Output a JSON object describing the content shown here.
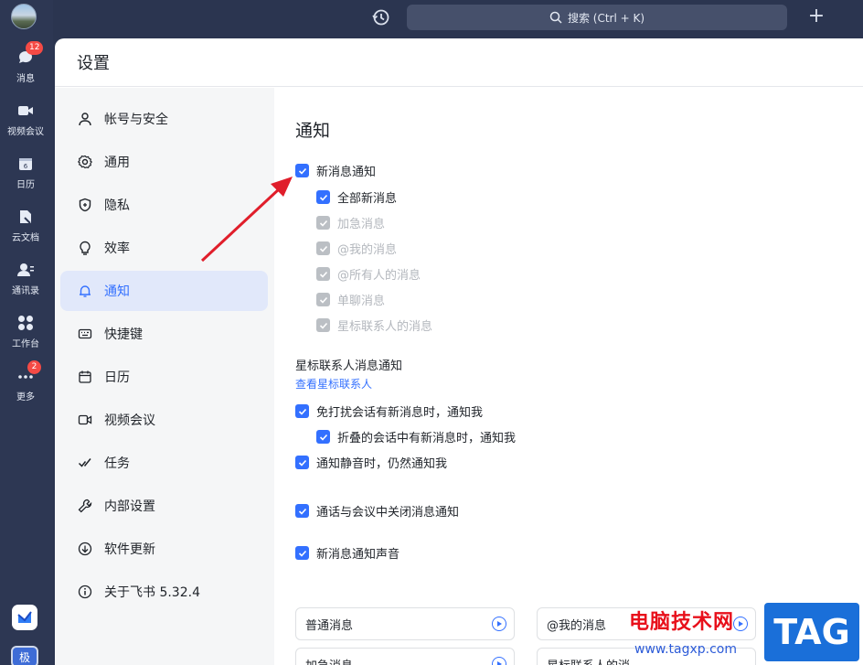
{
  "rail": {
    "items": [
      {
        "label": "消息",
        "icon": "chat-icon",
        "badge": "12"
      },
      {
        "label": "视频会议",
        "icon": "video-icon"
      },
      {
        "label": "日历",
        "icon": "calendar-icon",
        "sub": "6"
      },
      {
        "label": "云文档",
        "icon": "docs-icon"
      },
      {
        "label": "通讯录",
        "icon": "contacts-icon"
      },
      {
        "label": "工作台",
        "icon": "workspace-icon"
      },
      {
        "label": "更多",
        "icon": "more-icon",
        "badge": "2"
      }
    ],
    "user_initial": "极"
  },
  "topbar": {
    "search_text": "搜索 (Ctrl + K)"
  },
  "window": {
    "title": "设置"
  },
  "nav": {
    "items": [
      {
        "label": "帐号与安全",
        "icon": "user-icon"
      },
      {
        "label": "通用",
        "icon": "gear-icon"
      },
      {
        "label": "隐私",
        "icon": "shield-icon"
      },
      {
        "label": "效率",
        "icon": "bulb-icon"
      },
      {
        "label": "通知",
        "icon": "bell-icon",
        "active": true
      },
      {
        "label": "快捷键",
        "icon": "keyboard-icon"
      },
      {
        "label": "日历",
        "icon": "calendar-icon"
      },
      {
        "label": "视频会议",
        "icon": "video-icon"
      },
      {
        "label": "任务",
        "icon": "task-icon"
      },
      {
        "label": "内部设置",
        "icon": "wrench-icon"
      },
      {
        "label": "软件更新",
        "icon": "update-icon"
      },
      {
        "label": "关于飞书 5.32.4",
        "icon": "info-icon"
      }
    ]
  },
  "notify": {
    "title": "通知",
    "new_msg": "新消息通知",
    "sub": [
      "全部新消息",
      "加急消息",
      "@我的消息",
      "@所有人的消息",
      "单聊消息",
      "星标联系人的消息"
    ],
    "starred_title": "星标联系人消息通知",
    "starred_link": "查看星标联系人",
    "dnd": "免打扰会话有新消息时，通知我",
    "folded": "折叠的会话中有新消息时，通知我",
    "mute": "通知静音时，仍然通知我",
    "call": "通话与会议中关闭消息通知",
    "sound": "新消息通知声音",
    "sounds": [
      "普通消息",
      "@我的消息",
      "加急消息",
      "星标联系人的消"
    ]
  },
  "watermark": {
    "text": "电脑技术网",
    "url": "www.tagxp.com",
    "tag": "TAG"
  }
}
